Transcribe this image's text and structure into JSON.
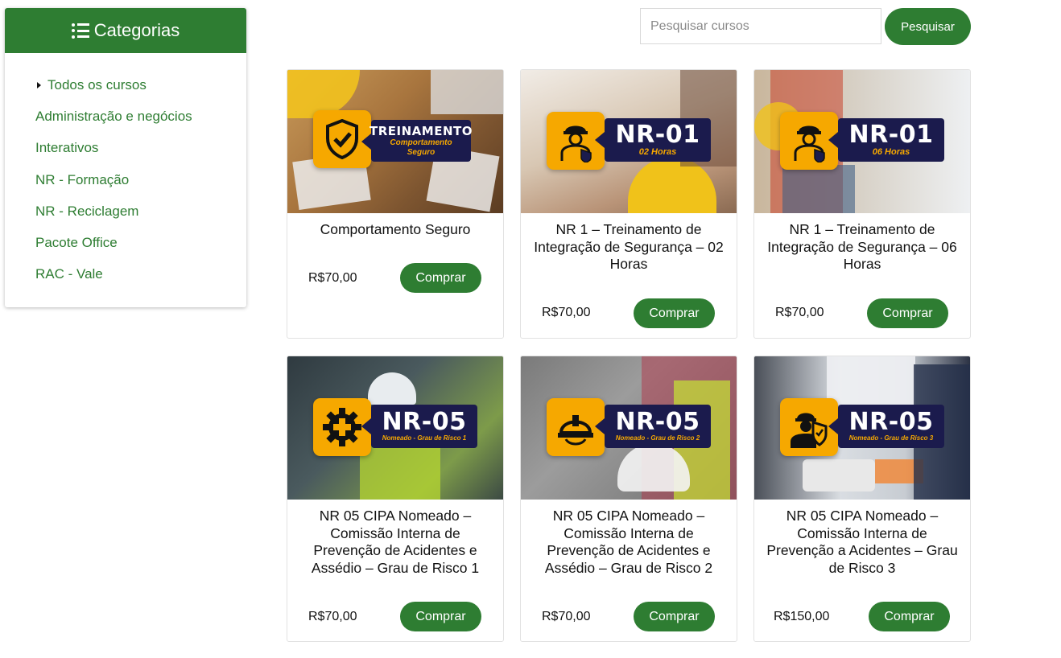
{
  "sidebar": {
    "title": "Categorias",
    "icon": "list-icon",
    "items": [
      {
        "label": "Todos os cursos"
      },
      {
        "label": "Administração e negócios"
      },
      {
        "label": "Interativos"
      },
      {
        "label": "NR - Formação"
      },
      {
        "label": "NR - Reciclagem"
      },
      {
        "label": "Pacote Office"
      },
      {
        "label": "RAC - Vale"
      }
    ]
  },
  "search": {
    "placeholder": "Pesquisar cursos",
    "value": "",
    "button_label": "Pesquisar"
  },
  "colors": {
    "brand_green": "#2e7d32",
    "badge_orange": "#f6a800",
    "banner_navy": "#1b1b4d"
  },
  "courses": [
    {
      "title": "Comportamento Seguro",
      "price": "R$70,00",
      "buy_label": "Comprar",
      "banner": {
        "main": "TREINAMENTO",
        "sub": "Comportamento Seguro",
        "icon": "shield-check-icon"
      }
    },
    {
      "title": "NR 1 – Treinamento de Integração de Segurança – 02 Horas",
      "price": "R$70,00",
      "buy_label": "Comprar",
      "banner": {
        "main": "NR-01",
        "sub": "02 Horas",
        "icon": "worker-icon"
      }
    },
    {
      "title": "NR 1 – Treinamento de Integração de Segurança – 06 Horas",
      "price": "R$70,00",
      "buy_label": "Comprar",
      "banner": {
        "main": "NR-01",
        "sub": "06 Horas",
        "icon": "worker-icon"
      }
    },
    {
      "title": "NR 05 CIPA Nomeado – Comissão Interna de Prevenção de Acidentes e Assédio – Grau de Risco 1",
      "price": "R$70,00",
      "buy_label": "Comprar",
      "banner": {
        "main": "NR-05",
        "sub": "Nomeado - Grau de Risco 1",
        "icon": "gear-cross-icon"
      }
    },
    {
      "title": "NR 05 CIPA Nomeado – Comissão Interna de Prevenção de Acidentes e Assédio – Grau de Risco 2",
      "price": "R$70,00",
      "buy_label": "Comprar",
      "banner": {
        "main": "NR-05",
        "sub": "Nomeado - Grau de Risco 2",
        "icon": "hardhat-icon"
      }
    },
    {
      "title": "NR 05 CIPA Nomeado – Comissão Interna de Prevenção a Acidentes – Grau de Risco 3",
      "price": "R$150,00",
      "buy_label": "Comprar",
      "banner": {
        "main": "NR-05",
        "sub": "Nomeado - Grau de Risco 3",
        "icon": "worker-shield-icon"
      }
    }
  ]
}
